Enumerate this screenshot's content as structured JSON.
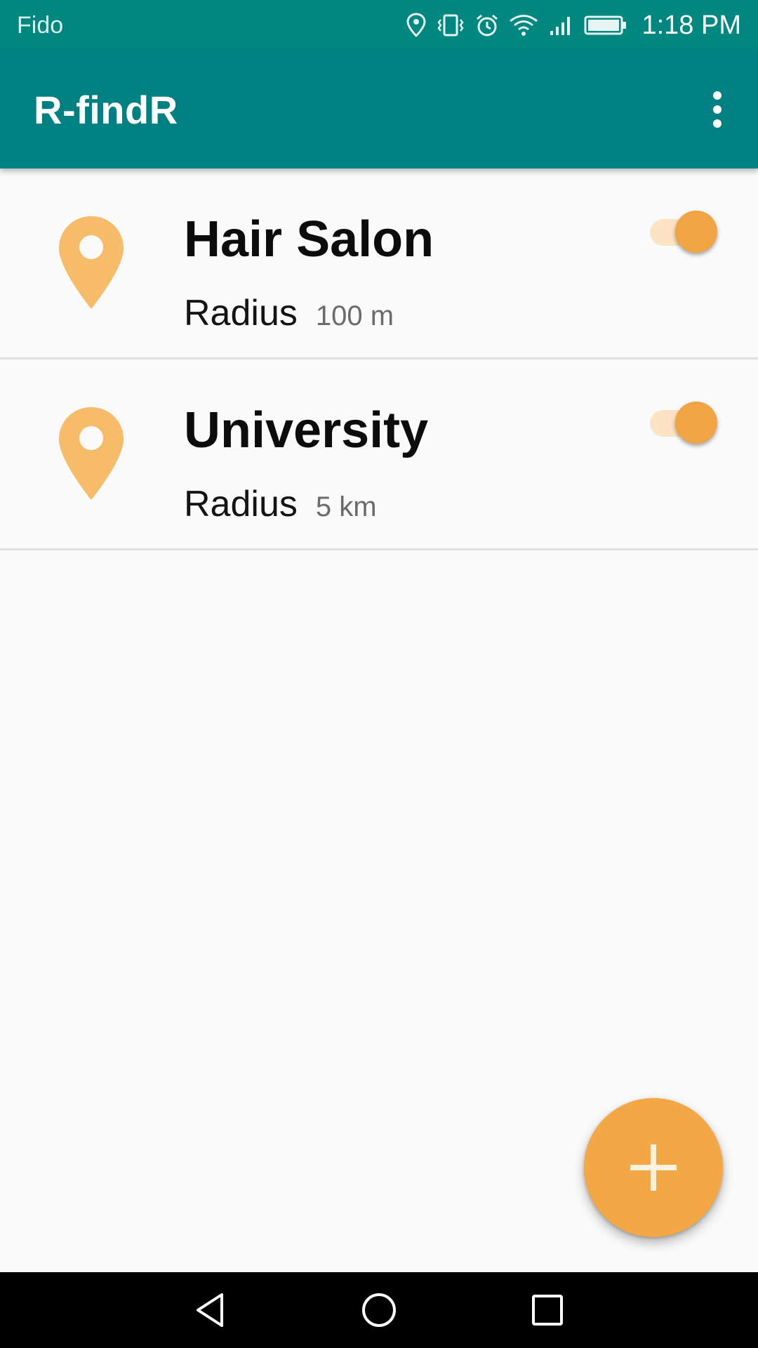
{
  "status_bar": {
    "carrier": "Fido",
    "time": "1:18 PM",
    "icons": [
      "location-icon",
      "vibrate-icon",
      "alarm-icon",
      "wifi-icon",
      "signal-icon",
      "battery-icon"
    ]
  },
  "app_bar": {
    "title": "R-findR",
    "overflow_icon": "more-vert-icon"
  },
  "places": [
    {
      "name": "Hair Salon",
      "radius_label": "Radius",
      "radius_value": "100 m",
      "enabled": true
    },
    {
      "name": "University",
      "radius_label": "Radius",
      "radius_value": "5 km",
      "enabled": true
    }
  ],
  "fab": {
    "icon": "add-icon"
  },
  "nav_bar": {
    "icons": [
      "back-icon",
      "home-icon",
      "recents-icon"
    ]
  },
  "colors": {
    "status_bar": "#00877f",
    "app_bar": "#008080",
    "accent": "#f3a845",
    "pin": "#f7bc6a",
    "switch_track": "#fbe3c3",
    "background": "#fafafa"
  }
}
